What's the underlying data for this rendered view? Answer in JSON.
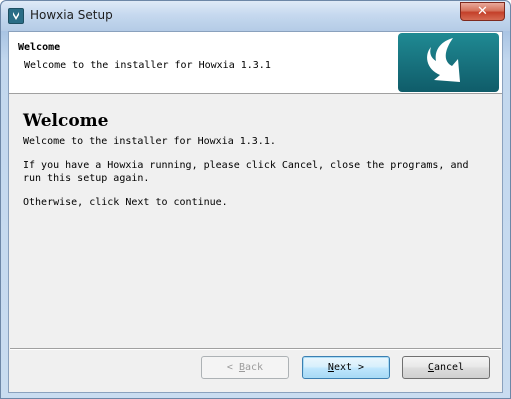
{
  "window": {
    "title": "Howxia Setup",
    "close_glyph": "✕"
  },
  "header": {
    "title": "Welcome",
    "subtitle": "Welcome to the installer for Howxia 1.3.1",
    "logo_icon": "download-arrow-icon"
  },
  "body": {
    "heading": "Welcome",
    "lines": [
      "Welcome to the installer for Howxia 1.3.1.",
      "If you have a Howxia running, please click Cancel, close the programs, and",
      "run this setup again.",
      "Otherwise, click Next to continue."
    ]
  },
  "buttons": {
    "back": {
      "prefix": "< ",
      "mnemonic": "B",
      "rest": "ack",
      "enabled": false
    },
    "next": {
      "mnemonic": "N",
      "rest": "ext",
      "suffix": " >",
      "enabled": true
    },
    "cancel": {
      "mnemonic": "C",
      "rest": "ancel",
      "enabled": true
    }
  },
  "colors": {
    "accent": "#17707c",
    "default_button_border": "#3c7fb1"
  }
}
